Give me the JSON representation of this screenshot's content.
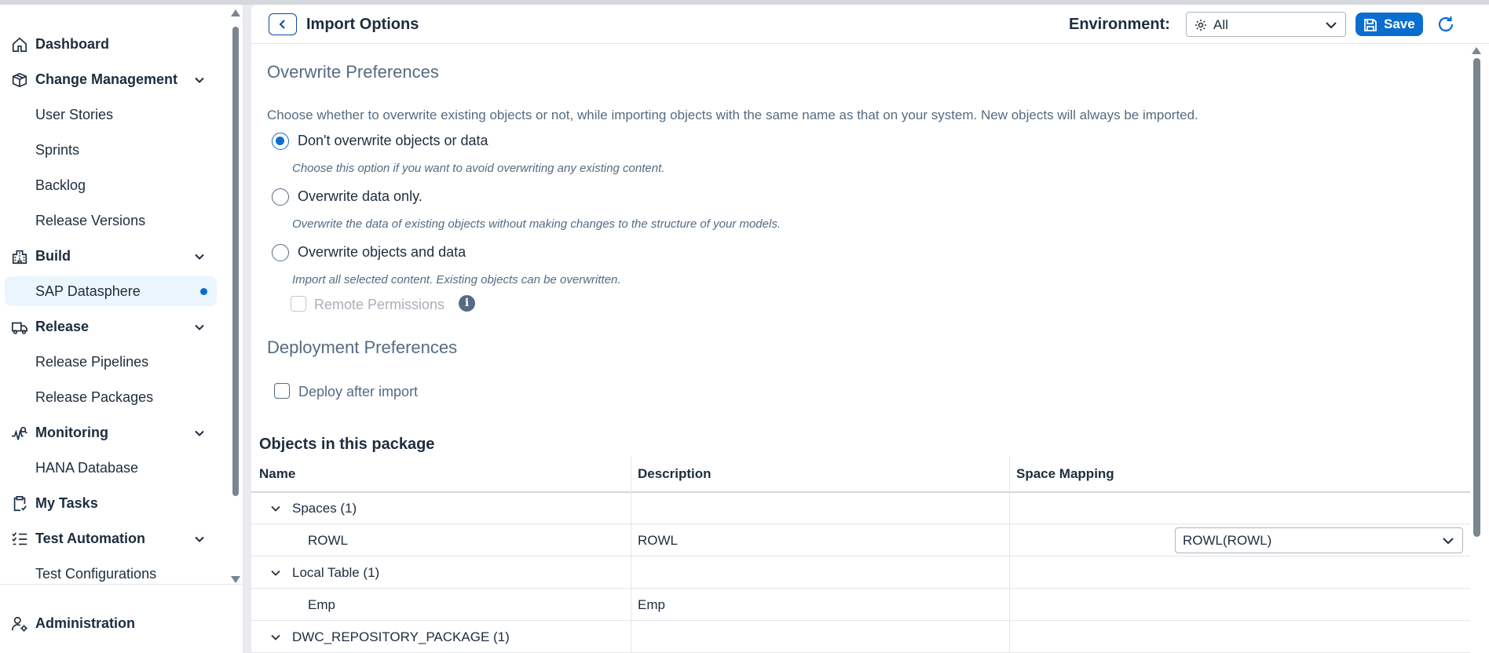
{
  "sidebar": {
    "items": [
      {
        "label": "Dashboard",
        "icon": "home-icon",
        "type": "group"
      },
      {
        "label": "Change Management",
        "icon": "cube-icon",
        "type": "group",
        "expandable": true
      },
      {
        "label": "User Stories",
        "type": "sub"
      },
      {
        "label": "Sprints",
        "type": "sub"
      },
      {
        "label": "Backlog",
        "type": "sub"
      },
      {
        "label": "Release Versions",
        "type": "sub"
      },
      {
        "label": "Build",
        "icon": "building-icon",
        "type": "group",
        "expandable": true
      },
      {
        "label": "SAP Datasphere",
        "type": "sub",
        "selected": true
      },
      {
        "label": "Release",
        "icon": "truck-icon",
        "type": "group",
        "expandable": true
      },
      {
        "label": "Release Pipelines",
        "type": "sub"
      },
      {
        "label": "Release Packages",
        "type": "sub"
      },
      {
        "label": "Monitoring",
        "icon": "monitoring-icon",
        "type": "group",
        "expandable": true
      },
      {
        "label": "HANA Database",
        "type": "sub"
      },
      {
        "label": "My Tasks",
        "icon": "clipboard-icon",
        "type": "group"
      },
      {
        "label": "Test Automation",
        "icon": "checklist-icon",
        "type": "group",
        "expandable": true
      },
      {
        "label": "Test Configurations",
        "type": "sub"
      }
    ],
    "footer": {
      "label": "Administration",
      "icon": "user-settings-icon"
    }
  },
  "header": {
    "title": "Import Options",
    "environment_label": "Environment:",
    "environment_value": "All",
    "save_label": "Save"
  },
  "overwrite": {
    "title": "Overwrite Preferences",
    "description": "Choose whether to overwrite existing objects or not, while importing objects with the same name as that on your system. New objects will always be imported.",
    "options": [
      {
        "label": "Don't overwrite objects or data",
        "hint": "Choose this option if you want to avoid overwriting any existing content.",
        "selected": true
      },
      {
        "label": "Overwrite data only.",
        "hint": "Overwrite the data of existing objects without making changes to the structure of your models.",
        "selected": false
      },
      {
        "label": "Overwrite objects and data",
        "hint": "Import all selected content. Existing objects can be overwritten.",
        "selected": false
      }
    ],
    "remote_permissions_label": "Remote Permissions"
  },
  "deployment": {
    "title": "Deployment Preferences",
    "deploy_label": "Deploy after import"
  },
  "objects": {
    "title": "Objects in this package",
    "columns": [
      "Name",
      "Description",
      "Space Mapping"
    ],
    "rows": [
      {
        "name": "Spaces (1)",
        "description": "",
        "mapping": "",
        "group": true
      },
      {
        "name": "ROWL",
        "description": "ROWL",
        "mapping": "ROWL(ROWL)",
        "group": false
      },
      {
        "name": "Local Table (1)",
        "description": "",
        "mapping": "",
        "group": true
      },
      {
        "name": "Emp",
        "description": "Emp",
        "mapping": "",
        "group": false
      },
      {
        "name": "DWC_REPOSITORY_PACKAGE (1)",
        "description": "",
        "mapping": "",
        "group": true
      }
    ]
  },
  "colors": {
    "accent": "#0a6ed1",
    "text": "#1d2d3e",
    "muted": "#556b82",
    "selected_bg": "#ebf5fe"
  }
}
